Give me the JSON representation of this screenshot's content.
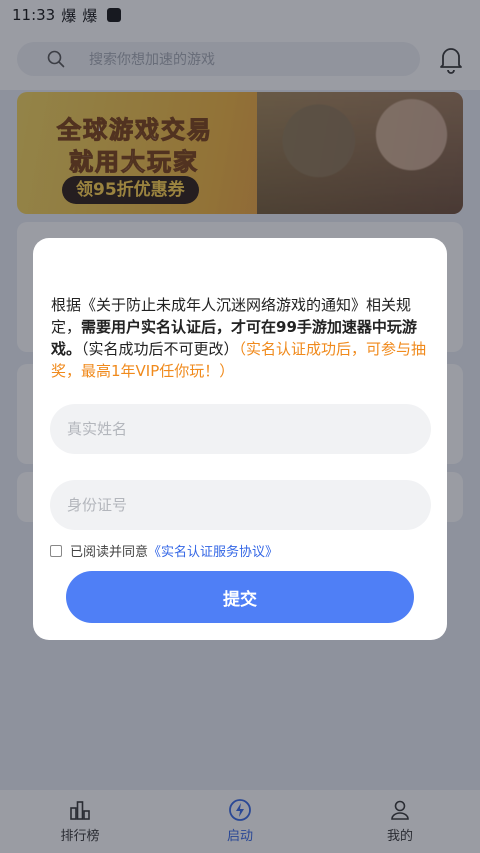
{
  "status_bar": {
    "time": "11:33",
    "icon1": "爆",
    "icon2": "爆"
  },
  "search": {
    "placeholder": "搜索你想加速的游戏"
  },
  "banner": {
    "line1": "全球游戏交易",
    "line2": "就用大玩家",
    "coupon": "领95折优惠券"
  },
  "dialog": {
    "text_plain_1": "根据《关于防止未成年人沉迷网络游戏的通知》相关规定，",
    "text_bold": "需要用户实名认证后，才可在99手游加速器中玩游戏。",
    "text_plain_2": "（实名成功后不可更改）",
    "text_orange": "（实名认证成功后，可参与抽奖，最高1年VIP任你玩！）",
    "name_placeholder": "真实姓名",
    "id_placeholder": "身份证号",
    "agree_text": "已阅读并同意",
    "agree_link": "《实名认证服务协议》",
    "submit_label": "提交"
  },
  "bottom_nav": {
    "items": [
      {
        "label": "排行榜",
        "icon": "ranking-icon"
      },
      {
        "label": "启动",
        "icon": "lightning-icon"
      },
      {
        "label": "我的",
        "icon": "profile-icon"
      }
    ],
    "active_index": 1
  },
  "colors": {
    "accent": "#4f7ff6",
    "link": "#3467e6",
    "warning": "#f08a1c"
  }
}
